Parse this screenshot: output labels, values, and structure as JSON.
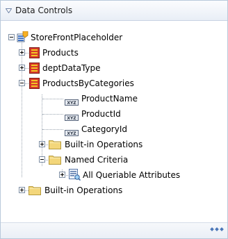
{
  "panel": {
    "title": "Data Controls",
    "collapse_icon": "triangle-down-icon"
  },
  "tree": {
    "root": {
      "label": "StoreFrontPlaceholder",
      "icon": "datacontrol-icon",
      "expanded": true
    },
    "products": {
      "label": "Products",
      "icon": "collection-icon",
      "expanded": false
    },
    "dept": {
      "label": "deptDataType",
      "icon": "collection-icon",
      "expanded": false
    },
    "pbc": {
      "label": "ProductsByCategories",
      "icon": "collection-icon",
      "expanded": true
    },
    "product_name": {
      "label": "ProductName",
      "icon": "attribute-icon",
      "badge": "XYZ"
    },
    "product_id": {
      "label": "ProductId",
      "icon": "attribute-icon",
      "badge": "XYZ"
    },
    "category_id": {
      "label": "CategoryId",
      "icon": "attribute-icon",
      "badge": "XYZ"
    },
    "builtin_inner": {
      "label": "Built-in Operations",
      "icon": "folder-icon",
      "expanded": false
    },
    "named_criteria": {
      "label": "Named Criteria",
      "icon": "folder-icon",
      "expanded": true
    },
    "all_queriable": {
      "label": "All Queriable Attributes",
      "icon": "view-criteria-icon",
      "expanded": false
    },
    "builtin_outer": {
      "label": "Built-in Operations",
      "icon": "folder-icon",
      "expanded": false
    }
  },
  "footer": {
    "overflow_icon": "more-dots-icon"
  },
  "colors": {
    "accent": "#4a76b8",
    "collection_red": "#d6382c",
    "collection_yellow": "#f3c623",
    "folder": "#f3d67a"
  }
}
